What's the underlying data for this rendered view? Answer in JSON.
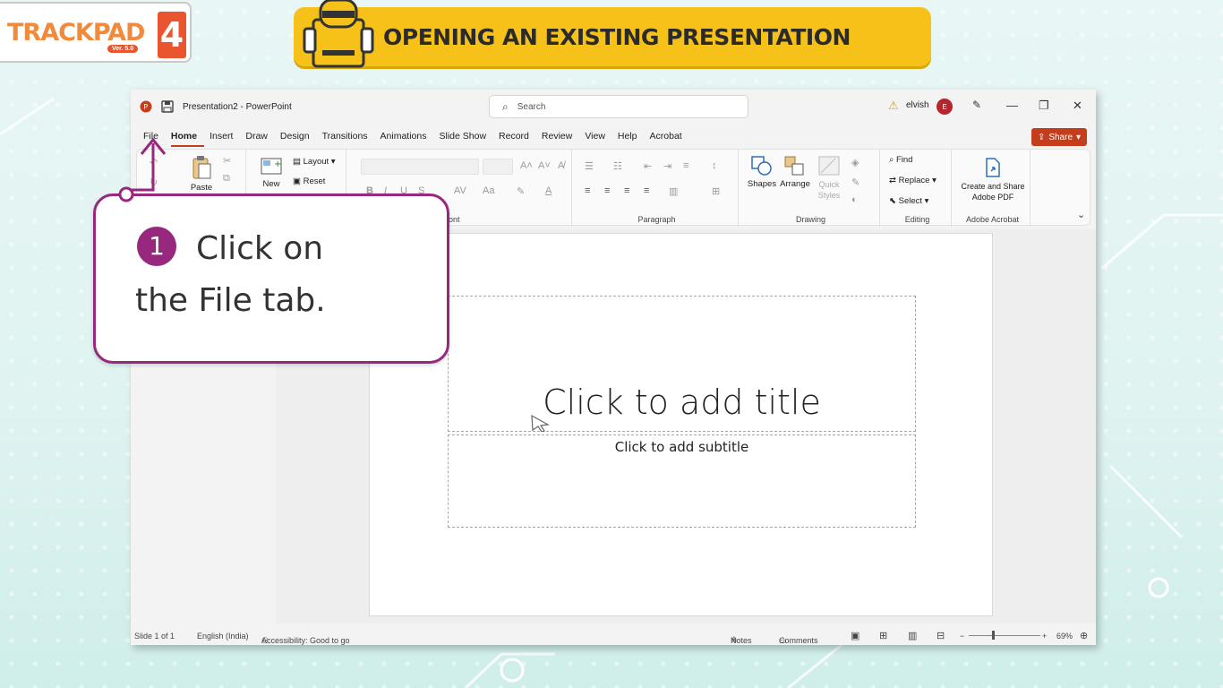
{
  "logo": {
    "text": "TRACKPAD",
    "version": "Ver. 5.0",
    "number": "4"
  },
  "banner": {
    "title": "OPENING AN EXISTING PRESENTATION"
  },
  "window": {
    "title": "Presentation2  -  PowerPoint",
    "search_placeholder": "Search",
    "user_name": "elvish",
    "avatar_initial": "E"
  },
  "tabs": [
    "File",
    "Home",
    "Insert",
    "Draw",
    "Design",
    "Transitions",
    "Animations",
    "Slide Show",
    "Record",
    "Review",
    "View",
    "Help",
    "Acrobat"
  ],
  "active_tab": "Home",
  "share_label": "Share",
  "ribbon": {
    "clipboard": {
      "paste": "Paste"
    },
    "slides": {
      "new": "New",
      "layout": "Layout",
      "reset": "Reset"
    },
    "font": {
      "label": "ont"
    },
    "paragraph": {
      "label": "Paragraph"
    },
    "drawing": {
      "shapes": "Shapes",
      "arrange": "Arrange",
      "quick_styles": "Quick Styles",
      "label": "Drawing"
    },
    "editing": {
      "find": "Find",
      "replace": "Replace",
      "select": "Select",
      "label": "Editing"
    },
    "acrobat": {
      "create_share": "Create and Share Adobe PDF",
      "label": "Adobe Acrobat"
    }
  },
  "slide": {
    "title_placeholder": "Click to add title",
    "subtitle_placeholder": "Click to add subtitle"
  },
  "statusbar": {
    "slide_count": "Slide 1 of 1",
    "language": "English (India)",
    "accessibility": "Accessibility: Good to go",
    "notes": "Notes",
    "comments": "Comments",
    "zoom": "69%"
  },
  "callout": {
    "step": "1",
    "line1": "Click on",
    "line2": "the File tab."
  },
  "colors": {
    "accent_purple": "#97287d",
    "banner_yellow": "#f6c21a",
    "ppt_red": "#c43e1c",
    "logo_orange": "#e8552e"
  }
}
